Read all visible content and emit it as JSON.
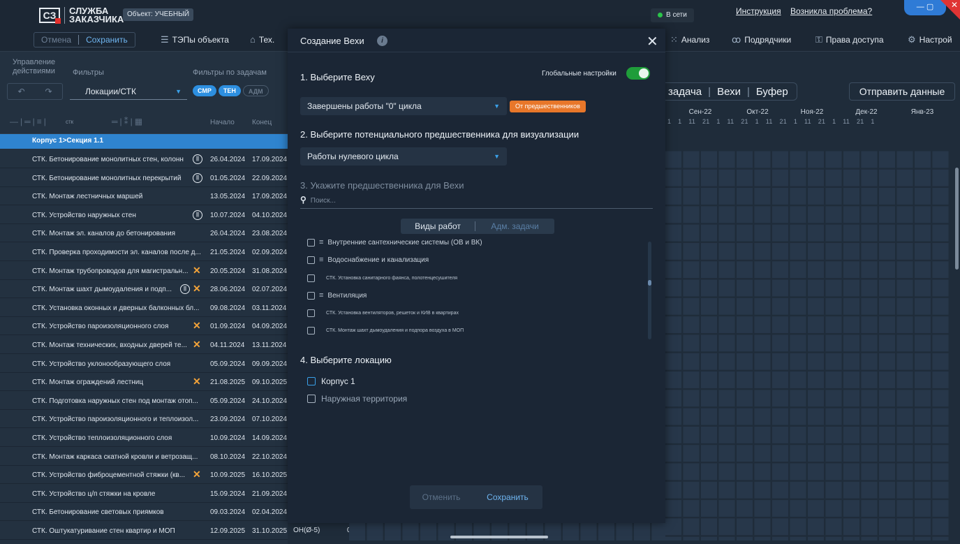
{
  "header": {
    "logo_mark": "СЗ",
    "logo_line1": "СЛУЖБА",
    "logo_line2": "ЗАКАЗЧИКА",
    "object_badge": "Объект: УЧЕБНЫЙ",
    "status": "В сети",
    "link_instructions": "Инструкция",
    "link_problem": "Возникла проблема?"
  },
  "toolbar": {
    "cancel": "Отмена",
    "save": "Сохранить",
    "items": [
      {
        "label": "ТЭПы объекта",
        "icon": "list-icon"
      },
      {
        "label": "Тех.",
        "icon": "building-icon"
      },
      {
        "label": "Анализ",
        "icon": "grid-icon"
      },
      {
        "label": "Подрядчики",
        "icon": "contractors-icon"
      },
      {
        "label": "Права доступа",
        "icon": "access-icon"
      },
      {
        "label": "Настрой",
        "icon": "gear-icon"
      }
    ]
  },
  "left": {
    "group_actions": "Управление действиями",
    "filters": "Фильтры",
    "task_filters": "Фильтры по задачам",
    "location_select": "Локации/СТК",
    "chips": [
      "СМР",
      "ТЕН",
      "АДМ"
    ],
    "stk_label": "стк",
    "col_start": "Начало",
    "col_end": "Конец",
    "section": "Корпус 1>Секция 1.1",
    "rows": [
      {
        "name": "СТК. Бетонирование монолитных стен, колонн",
        "start": "26.04.2024",
        "end": "17.09.2024",
        "mark": "pause"
      },
      {
        "name": "СТК. Бетонирование монолитных перекрытий",
        "start": "01.05.2024",
        "end": "22.09.2024",
        "mark": "pause"
      },
      {
        "name": "СТК. Монтаж лестничных маршей",
        "start": "13.05.2024",
        "end": "17.09.2024",
        "mark": ""
      },
      {
        "name": "СТК. Устройство наружных стен",
        "start": "10.07.2024",
        "end": "04.10.2024",
        "mark": "pause"
      },
      {
        "name": "СТК. Монтаж эл. каналов до бетонирования",
        "start": "26.04.2024",
        "end": "23.08.2024",
        "mark": ""
      },
      {
        "name": "СТК. Проверка проходимости эл. каналов после д...",
        "start": "21.05.2024",
        "end": "02.09.2024",
        "mark": ""
      },
      {
        "name": "СТК. Монтаж трубопроводов для магистральн...",
        "start": "20.05.2024",
        "end": "31.08.2024",
        "mark": "cross"
      },
      {
        "name": "СТК. Монтаж шахт дымоудаления и подп...",
        "start": "28.06.2024",
        "end": "02.07.2024",
        "mark": "pause-cross"
      },
      {
        "name": "СТК. Установка оконных и дверных балконных бл...",
        "start": "09.08.2024",
        "end": "03.11.2024",
        "mark": ""
      },
      {
        "name": "СТК. Устройство пароизоляционного слоя",
        "start": "01.09.2024",
        "end": "04.09.2024",
        "mark": "cross"
      },
      {
        "name": "СТК. Монтаж технических, входных дверей те...",
        "start": "04.11.2024",
        "end": "13.11.2024",
        "mark": "cross"
      },
      {
        "name": "СТК. Устройство уклонообразующего слоя",
        "start": "05.09.2024",
        "end": "09.09.2024",
        "mark": ""
      },
      {
        "name": "СТК. Монтаж ограждений лестниц",
        "start": "21.08.2025",
        "end": "09.10.2025",
        "mark": "cross"
      },
      {
        "name": "СТК. Подготовка наружных стен под монтаж отоп...",
        "start": "05.09.2024",
        "end": "24.10.2024",
        "mark": ""
      },
      {
        "name": "СТК. Устройство пароизоляционного и теплоизол...",
        "start": "23.09.2024",
        "end": "07.10.2024",
        "mark": ""
      },
      {
        "name": "СТК. Устройство теплоизоляционного слоя",
        "start": "10.09.2024",
        "end": "14.09.2024",
        "mark": ""
      },
      {
        "name": "СТК. Монтаж каркаса скатной кровли и ветрозащ...",
        "start": "08.10.2024",
        "end": "22.10.2024",
        "mark": ""
      },
      {
        "name": "СТК. Устройство фиброцементной стяжки (кв...",
        "start": "10.09.2025",
        "end": "16.10.2025",
        "mark": "cross"
      },
      {
        "name": "СТК. Устройство ц/п стяжки на кровле",
        "start": "15.09.2024",
        "end": "21.09.2024",
        "mark": ""
      },
      {
        "name": "СТК. Бетонирование световых приямков",
        "start": "09.03.2024",
        "end": "02.04.2024",
        "mark": ""
      },
      {
        "name": "СТК. Оштукатуривание стен квартир и МОП",
        "start": "12.09.2025",
        "end": "31.10.2025",
        "mark": ""
      }
    ],
    "last_row_extra": "ОН(Ø-5)",
    "last_row_value": "0"
  },
  "right": {
    "tabs": [
      "задача",
      "Вехи",
      "Буфер"
    ],
    "send_button": "Отправить данные",
    "months": [
      "Сен-22",
      "Окт-22",
      "Ноя-22",
      "Дек-22",
      "Янв-23"
    ],
    "days": "1  1  11  21  1  11  21  1  11  21  1  11  21  1  11  21  1"
  },
  "modal": {
    "title": "Создание Вехи",
    "info": "i",
    "close": "✕",
    "step1": "1. Выберите Веху",
    "global_settings": "Глобальные настройки",
    "global_on": true,
    "milestone_value": "Завершены работы \"0\" цикла",
    "from_predecessors": "От предшественников",
    "step2": "2. Выберите потенциального предшественника для визуализации",
    "predecessor_value": "Работы нулевого цикла",
    "step3": "3. Укажите предшественника для Вехи",
    "search_placeholder": "Поиск...",
    "seg_work": "Виды работ",
    "seg_adm": "Адм. задачи",
    "tree": [
      {
        "label": "Внутренние сантехнические системы (ОВ и ВК)",
        "level": "group"
      },
      {
        "label": "Водоснабжение и канализация",
        "level": "group"
      },
      {
        "label": "СТК. Установка санитарного фаянса, полотенцесушителя",
        "level": "item"
      },
      {
        "label": "Вентиляция",
        "level": "group"
      },
      {
        "label": "СТК. Установка вентиляторов, решеток и КИВ в квартирах",
        "level": "item"
      },
      {
        "label": "СТК. Монтаж шахт дымоудаления и подпора воздуха в МОП",
        "level": "item"
      }
    ],
    "step4": "4. Выберите локацию",
    "locations": [
      "Корпус 1",
      "Наружная территория"
    ],
    "cancel": "Отменить",
    "save": "Сохранить"
  }
}
